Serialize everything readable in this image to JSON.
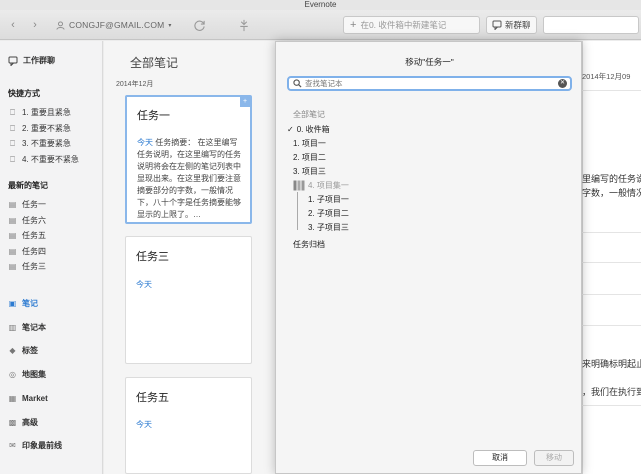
{
  "window": {
    "title": "Evernote"
  },
  "toolbar": {
    "account": "CONGJF@GMAIL.COM",
    "new_note": "在0. 收件箱中新建笔记",
    "new_chat": "新群聊"
  },
  "sidebar": {
    "work_chat": "工作群聊",
    "shortcuts_header": "快捷方式",
    "shortcuts": [
      "1. 重要且紧急",
      "2. 重要不紧急",
      "3. 不重要紧急",
      "4. 不重要不紧急"
    ],
    "recent_header": "最新的笔记",
    "recent": [
      "任务一",
      "任务六",
      "任务五",
      "任务四",
      "任务三"
    ],
    "nav": {
      "notes": "笔记",
      "notebooks": "笔记本",
      "tags": "标签",
      "atlas": "地图集",
      "market": "Market",
      "premium": "高级",
      "trunk": "印象最前线"
    }
  },
  "notelist": {
    "title": "全部笔记",
    "date_group": "2014年12月",
    "cards": [
      {
        "title": "任务一",
        "snippet_highlight": "今天",
        "snippet": " 任务摘要： 在这里编写任务说明，在这里编写的任务说明将会在左侧的笔记列表中显现出来。在这里我们要注意摘要部分的字数，一般情况下，八十个字是任务摘要能够显示的上限了。…"
      },
      {
        "title": "任务三",
        "date": "今天"
      },
      {
        "title": "任务五",
        "date": "今天"
      }
    ]
  },
  "notearea": {
    "date": "2014年12月09",
    "line1": "里编写的任务说",
    "line2": "字数，一般情况",
    "line3": "来明确标明起止",
    "line4": "，我们在执行到"
  },
  "dialog": {
    "title": "移动\"任务一\"",
    "search_placeholder": "查找笔记本",
    "all_notes": "全部笔记",
    "inbox": "0. 收件箱",
    "projects": [
      "1. 项目一",
      "2. 项目二",
      "3. 项目三"
    ],
    "stack": "4. 项目集一",
    "sub_projects": [
      "1. 子项目一",
      "2. 子项目二",
      "3. 子项目三"
    ],
    "archive": "任务归档",
    "cancel": "取消",
    "move": "移动"
  }
}
